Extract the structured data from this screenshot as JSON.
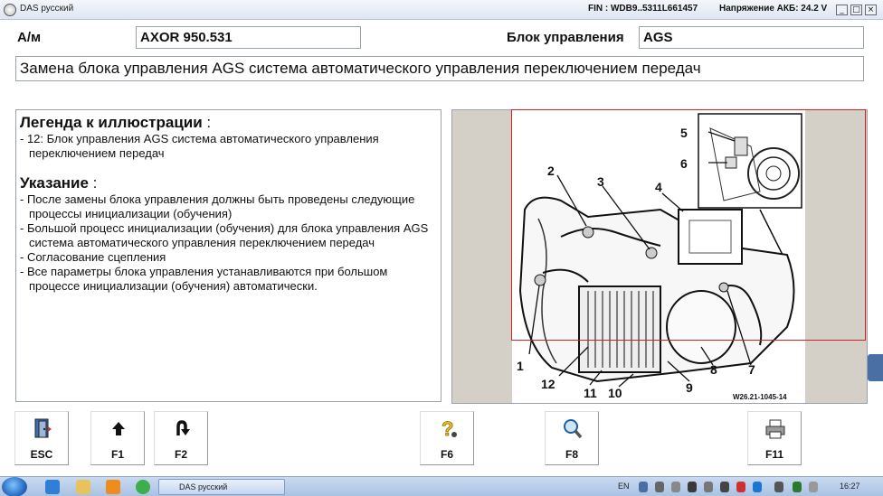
{
  "window": {
    "title": "DAS русский",
    "fin": "FIN : WDB9..5311L661457",
    "voltage": "Напряжение АКБ: 24.2 V"
  },
  "header": {
    "am_label": "А/м",
    "vehicle": "AXOR 950.531",
    "control_unit_label": "Блок управления",
    "control_unit": "AGS",
    "procedure_title": "Замена блока управления AGS система автоматического управления переключением передач"
  },
  "legend": {
    "heading": "Легенда к иллюстрации",
    "items": [
      "- 12: Блок управления AGS система автоматического управления переключением передач"
    ]
  },
  "notes": {
    "heading": "Указание",
    "items": [
      "- После замены блока управления должны быть проведены следующие процессы инициализации (обучения)",
      "- Большой процесс инициализации (обучения) для блока управления AGS система автоматического управления переключением передач",
      "- Согласование сцепления",
      "- Все параметры блока управления устанавливаются при большом процессе инициализации (обучения) автоматически."
    ]
  },
  "figure": {
    "callouts": [
      "1",
      "2",
      "3",
      "4",
      "5",
      "6",
      "7",
      "8",
      "9",
      "10",
      "11",
      "12"
    ],
    "ref": "W26.21-1045-14"
  },
  "toolbar": {
    "buttons": [
      {
        "label": "ESC",
        "icon": "exit-door-icon"
      },
      {
        "label": "F1",
        "icon": "arrow-up-icon"
      },
      {
        "label": "F2",
        "icon": "u-turn-icon"
      },
      {
        "label": "F6",
        "icon": "help-question-icon"
      },
      {
        "label": "F8",
        "icon": "magnifier-icon"
      },
      {
        "label": "F11",
        "icon": "printer-icon"
      }
    ]
  },
  "taskbar": {
    "task_label": "DAS русский",
    "lang": "EN",
    "clock": "16:27"
  }
}
